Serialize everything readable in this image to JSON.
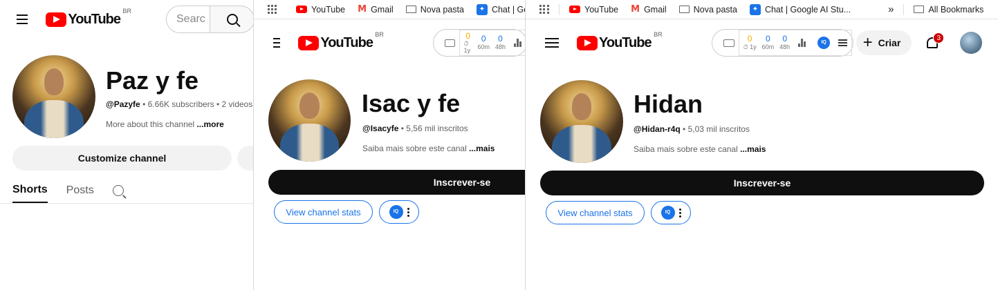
{
  "country_code": "BR",
  "bookmarks": {
    "youtube": "YouTube",
    "gmail": "Gmail",
    "nova_pasta": "Nova pasta",
    "chat_short": "Chat | Goo",
    "chat_long": "Chat | Google AI Stu...",
    "overflow": "»",
    "all_bookmarks": "All Bookmarks"
  },
  "ext_stats": [
    {
      "value": "0",
      "label": "1y"
    },
    {
      "value": "0",
      "label": "60m"
    },
    {
      "value": "0",
      "label": "48h"
    }
  ],
  "ext_stats_icon": "keyboard-icon",
  "window1": {
    "search_placeholder": "Searc",
    "channel_name": "Paz y fe",
    "handle": "@Pazyfe",
    "subscribers": "6.66K subscribers",
    "videos": "2 videos",
    "about_text": "More about this channel",
    "about_more": "...more",
    "customize_label": "Customize channel",
    "tabs": [
      "Shorts",
      "Posts"
    ]
  },
  "window2": {
    "channel_name": "Isac y fe",
    "handle": "@Isacyfe",
    "subscribers": "5,56 mil inscritos",
    "about_text": "Saiba mais sobre este canal",
    "about_more": "...mais",
    "subscribe_label": "Inscrever-se",
    "stats_label": "View channel stats"
  },
  "window3": {
    "channel_name": "Hidan",
    "handle": "@Hidan-r4q",
    "subscribers": "5,03 mil inscritos",
    "about_text": "Saiba mais sobre este canal",
    "about_more": "...mais",
    "subscribe_label": "Inscrever-se",
    "stats_label": "View channel stats",
    "create_label": "Criar",
    "notification_count": "3"
  },
  "colors": {
    "youtube_red": "#ff0000",
    "link_blue": "#1a73e8",
    "subscribe_black": "#0f0f0f",
    "badge_red": "#cc0000"
  }
}
